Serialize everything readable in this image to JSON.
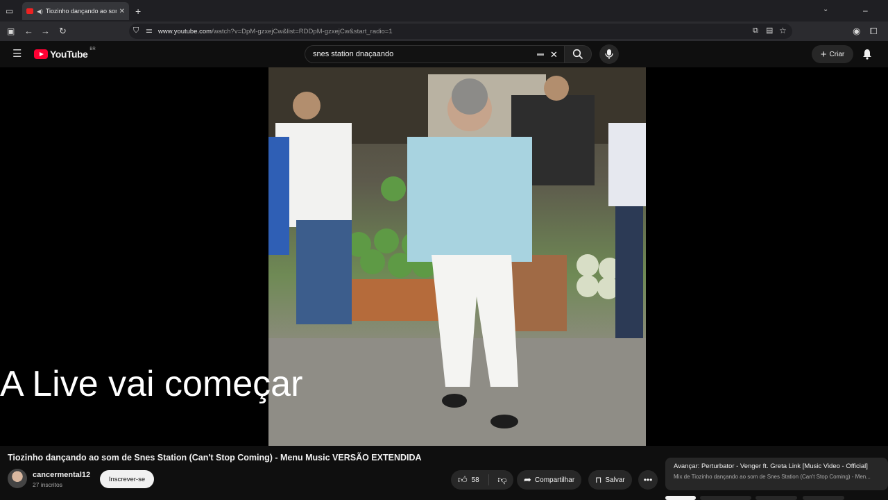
{
  "browser": {
    "tab_title": "Tiozinho dançando ao som",
    "url_host": "www.youtube.com",
    "url_path": "/watch?v=DpM-gzxejCw&list=RDDpM-gzxejCw&start_radio=1"
  },
  "youtube": {
    "logo_text": "YouTube",
    "country_code": "BR",
    "search_value": "snes station dnaçaando",
    "create_label": "Criar"
  },
  "player": {
    "overlay_caption": "A Live vai começar"
  },
  "video": {
    "title": "Tiozinho dançando ao som de Snes Station (Can't Stop Coming) - Menu Music VERSÃO EXTENDIDA",
    "channel_name": "cancermental12",
    "subscribers": "27 inscritos",
    "subscribe_label": "Inscrever-se",
    "likes": "58",
    "share_label": "Compartilhar",
    "save_label": "Salvar"
  },
  "up_next": {
    "title": "Avançar: Perturbator - Venger ft. Greta Link [Music Video - Official]",
    "subtitle": "Mix de Tiozinho dançando ao som de Snes Station (Can't Stop Coming) - Men..."
  },
  "colors": {
    "brand_red": "#ff0033",
    "background": "#0f0f0f"
  }
}
